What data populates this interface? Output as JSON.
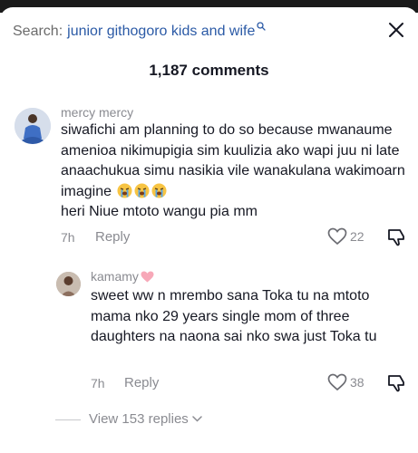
{
  "search": {
    "prefix": "Search:",
    "query": "junior githogoro kids and wife"
  },
  "header": {
    "comment_count": "1,187 comments"
  },
  "comments": [
    {
      "username": "mercy mercy",
      "text": "siwafichi am planning to do so because mwanaume amenioa nikimupigia sim kuulizia ako wapi juu ni late anaachukua simu nasikia vile wanakulana wakimoarn imagine",
      "text_end": "heri Niue mtoto wangu pia mm",
      "emojis": [
        "loudly-crying-face",
        "loudly-crying-face",
        "loudly-crying-face"
      ],
      "time": "7h",
      "reply_label": "Reply",
      "likes": "22"
    },
    {
      "username": "kamamy",
      "username_emoji": "pink-heart",
      "text": "sweet ww n mrembo sana Toka tu na mtoto mama nko 29 years single mom of three daughters na naona sai nko swa just Toka tu",
      "time": "7h",
      "reply_label": "Reply",
      "likes": "38"
    }
  ],
  "replies": {
    "label": "View 153 replies"
  },
  "icons": {
    "search": "search-icon",
    "close": "close-icon",
    "like": "heart-outline-icon",
    "dislike": "thumbs-down-icon",
    "chevron": "chevron-down-icon"
  },
  "colors": {
    "query": "#2b5aa6",
    "muted": "#8a8b91",
    "text": "#161823"
  }
}
